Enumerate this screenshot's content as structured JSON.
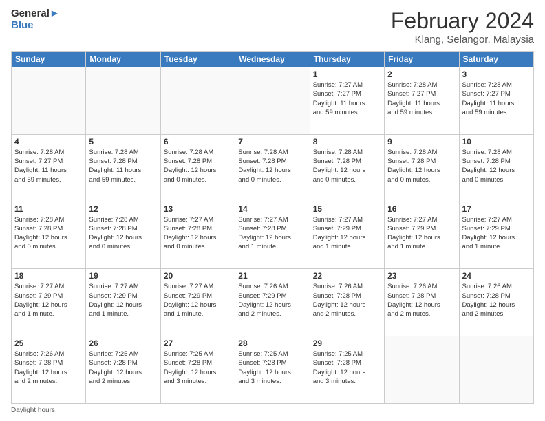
{
  "header": {
    "logo_line1": "General",
    "logo_line2": "Blue",
    "title": "February 2024",
    "subtitle": "Klang, Selangor, Malaysia"
  },
  "days_of_week": [
    "Sunday",
    "Monday",
    "Tuesday",
    "Wednesday",
    "Thursday",
    "Friday",
    "Saturday"
  ],
  "weeks": [
    [
      {
        "day": "",
        "info": ""
      },
      {
        "day": "",
        "info": ""
      },
      {
        "day": "",
        "info": ""
      },
      {
        "day": "",
        "info": ""
      },
      {
        "day": "1",
        "info": "Sunrise: 7:27 AM\nSunset: 7:27 PM\nDaylight: 11 hours\nand 59 minutes."
      },
      {
        "day": "2",
        "info": "Sunrise: 7:28 AM\nSunset: 7:27 PM\nDaylight: 11 hours\nand 59 minutes."
      },
      {
        "day": "3",
        "info": "Sunrise: 7:28 AM\nSunset: 7:27 PM\nDaylight: 11 hours\nand 59 minutes."
      }
    ],
    [
      {
        "day": "4",
        "info": "Sunrise: 7:28 AM\nSunset: 7:27 PM\nDaylight: 11 hours\nand 59 minutes."
      },
      {
        "day": "5",
        "info": "Sunrise: 7:28 AM\nSunset: 7:28 PM\nDaylight: 11 hours\nand 59 minutes."
      },
      {
        "day": "6",
        "info": "Sunrise: 7:28 AM\nSunset: 7:28 PM\nDaylight: 12 hours\nand 0 minutes."
      },
      {
        "day": "7",
        "info": "Sunrise: 7:28 AM\nSunset: 7:28 PM\nDaylight: 12 hours\nand 0 minutes."
      },
      {
        "day": "8",
        "info": "Sunrise: 7:28 AM\nSunset: 7:28 PM\nDaylight: 12 hours\nand 0 minutes."
      },
      {
        "day": "9",
        "info": "Sunrise: 7:28 AM\nSunset: 7:28 PM\nDaylight: 12 hours\nand 0 minutes."
      },
      {
        "day": "10",
        "info": "Sunrise: 7:28 AM\nSunset: 7:28 PM\nDaylight: 12 hours\nand 0 minutes."
      }
    ],
    [
      {
        "day": "11",
        "info": "Sunrise: 7:28 AM\nSunset: 7:28 PM\nDaylight: 12 hours\nand 0 minutes."
      },
      {
        "day": "12",
        "info": "Sunrise: 7:28 AM\nSunset: 7:28 PM\nDaylight: 12 hours\nand 0 minutes."
      },
      {
        "day": "13",
        "info": "Sunrise: 7:27 AM\nSunset: 7:28 PM\nDaylight: 12 hours\nand 0 minutes."
      },
      {
        "day": "14",
        "info": "Sunrise: 7:27 AM\nSunset: 7:28 PM\nDaylight: 12 hours\nand 1 minute."
      },
      {
        "day": "15",
        "info": "Sunrise: 7:27 AM\nSunset: 7:29 PM\nDaylight: 12 hours\nand 1 minute."
      },
      {
        "day": "16",
        "info": "Sunrise: 7:27 AM\nSunset: 7:29 PM\nDaylight: 12 hours\nand 1 minute."
      },
      {
        "day": "17",
        "info": "Sunrise: 7:27 AM\nSunset: 7:29 PM\nDaylight: 12 hours\nand 1 minute."
      }
    ],
    [
      {
        "day": "18",
        "info": "Sunrise: 7:27 AM\nSunset: 7:29 PM\nDaylight: 12 hours\nand 1 minute."
      },
      {
        "day": "19",
        "info": "Sunrise: 7:27 AM\nSunset: 7:29 PM\nDaylight: 12 hours\nand 1 minute."
      },
      {
        "day": "20",
        "info": "Sunrise: 7:27 AM\nSunset: 7:29 PM\nDaylight: 12 hours\nand 1 minute."
      },
      {
        "day": "21",
        "info": "Sunrise: 7:26 AM\nSunset: 7:29 PM\nDaylight: 12 hours\nand 2 minutes."
      },
      {
        "day": "22",
        "info": "Sunrise: 7:26 AM\nSunset: 7:28 PM\nDaylight: 12 hours\nand 2 minutes."
      },
      {
        "day": "23",
        "info": "Sunrise: 7:26 AM\nSunset: 7:28 PM\nDaylight: 12 hours\nand 2 minutes."
      },
      {
        "day": "24",
        "info": "Sunrise: 7:26 AM\nSunset: 7:28 PM\nDaylight: 12 hours\nand 2 minutes."
      }
    ],
    [
      {
        "day": "25",
        "info": "Sunrise: 7:26 AM\nSunset: 7:28 PM\nDaylight: 12 hours\nand 2 minutes."
      },
      {
        "day": "26",
        "info": "Sunrise: 7:25 AM\nSunset: 7:28 PM\nDaylight: 12 hours\nand 2 minutes."
      },
      {
        "day": "27",
        "info": "Sunrise: 7:25 AM\nSunset: 7:28 PM\nDaylight: 12 hours\nand 3 minutes."
      },
      {
        "day": "28",
        "info": "Sunrise: 7:25 AM\nSunset: 7:28 PM\nDaylight: 12 hours\nand 3 minutes."
      },
      {
        "day": "29",
        "info": "Sunrise: 7:25 AM\nSunset: 7:28 PM\nDaylight: 12 hours\nand 3 minutes."
      },
      {
        "day": "",
        "info": ""
      },
      {
        "day": "",
        "info": ""
      }
    ]
  ],
  "footer": {
    "note": "Daylight hours"
  }
}
